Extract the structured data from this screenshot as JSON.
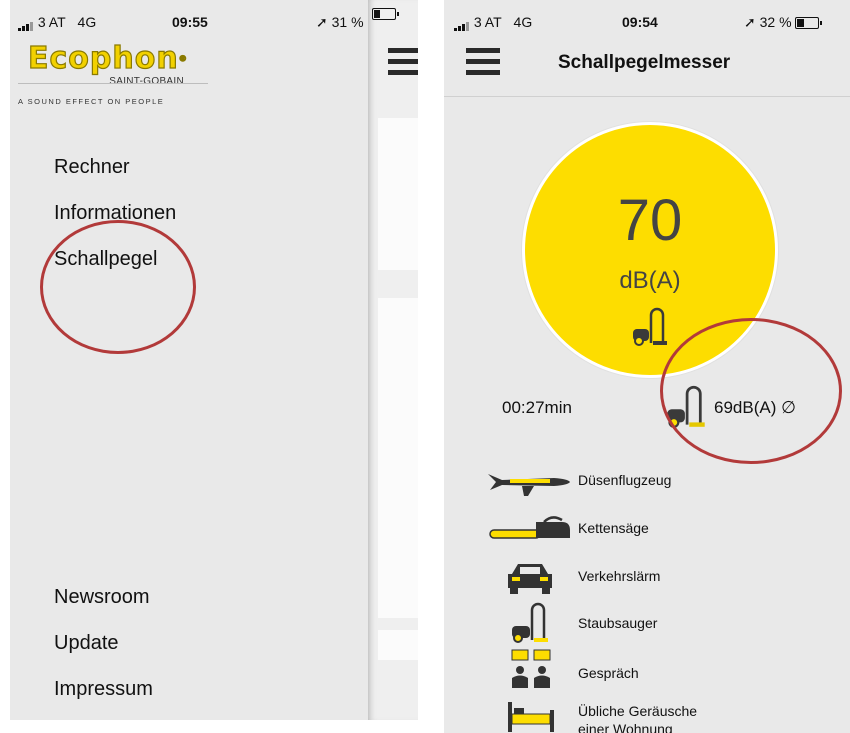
{
  "left_screen": {
    "status": {
      "carrier": "3 AT",
      "network": "4G",
      "time": "09:55",
      "battery": "31 %",
      "battery_level": 0.31
    },
    "logo": {
      "brand": "Ecophon",
      "subbrand": "SAINT-GOBAIN",
      "tagline": "A SOUND EFFECT ON PEOPLE"
    },
    "menu_top": [
      {
        "label": "Rechner"
      },
      {
        "label": "Informationen"
      },
      {
        "label": "Schallpegel"
      }
    ],
    "menu_bottom": [
      {
        "label": "Newsroom"
      },
      {
        "label": "Update"
      },
      {
        "label": "Impressum"
      }
    ]
  },
  "right_screen": {
    "status": {
      "carrier": "3 AT",
      "network": "4G",
      "time": "09:54",
      "battery": "32 %",
      "battery_level": 0.32
    },
    "title": "Schallpegelmesser",
    "meter": {
      "value": "70",
      "unit": "dB(A)",
      "icon": "vacuum-cleaner-icon"
    },
    "timer": "00:27min",
    "average": "69dB(A) ∅",
    "references": [
      {
        "label": "Düsenflugzeug",
        "icon": "jet-plane-icon"
      },
      {
        "label": "Kettensäge",
        "icon": "chainsaw-icon"
      },
      {
        "label": "Verkehrslärm",
        "icon": "car-icon"
      },
      {
        "label": "Staubsauger",
        "icon": "vacuum-cleaner-icon"
      },
      {
        "label": "Gespräch",
        "icon": "conversation-icon"
      },
      {
        "label": "Übliche Geräusche einer Wohnung",
        "icon": "bed-icon"
      }
    ]
  },
  "colors": {
    "accent_yellow": "#fddd00",
    "annotation_red": "#b23a3a",
    "background": "#e9e9e9"
  }
}
